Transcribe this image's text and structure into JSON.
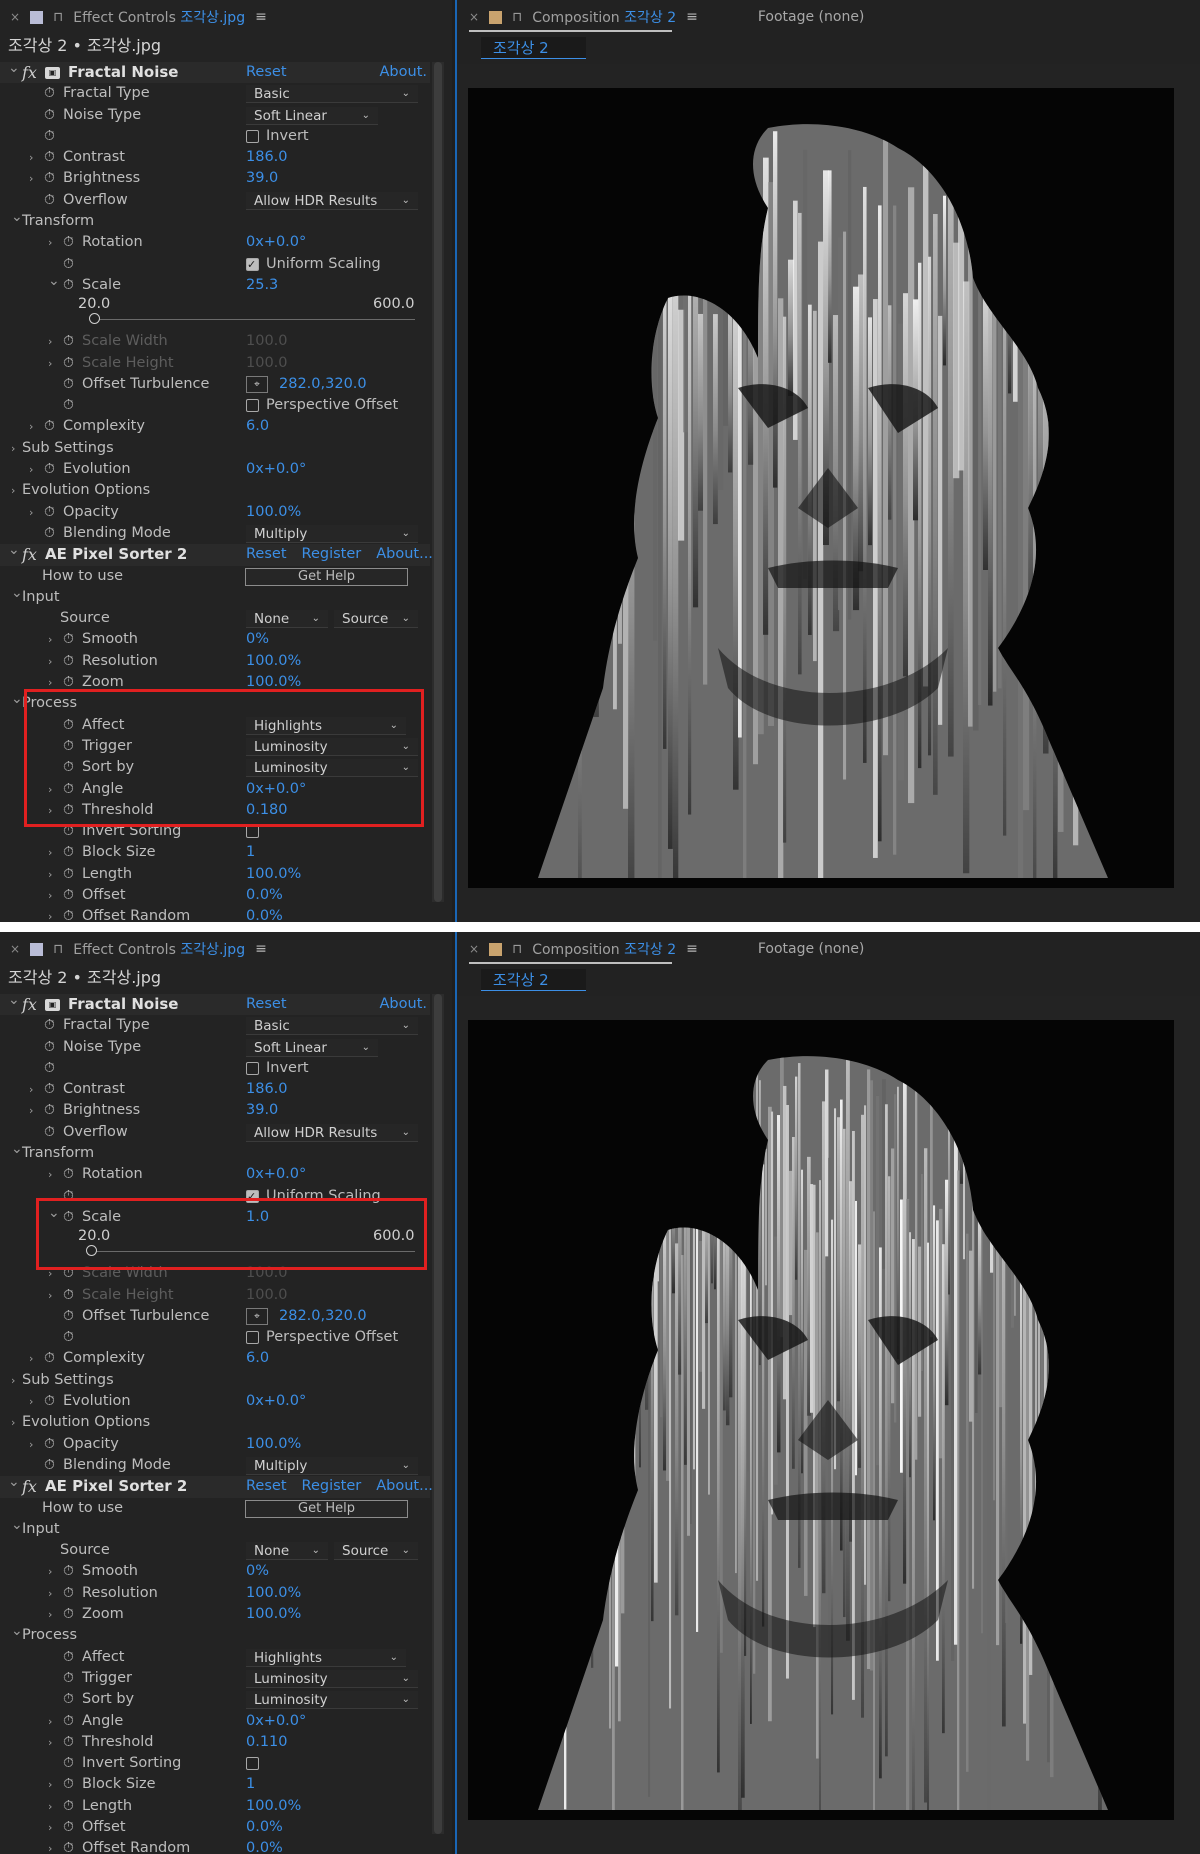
{
  "top": {
    "ec_tab": {
      "close": "×",
      "title_prefix": "Effect Controls",
      "title_name": "조각상.jpg",
      "menu": "≡"
    },
    "ec_header": "조각상 2 • 조각상.jpg",
    "comp_tab": {
      "close": "×",
      "title_prefix": "Composition",
      "title_name": "조각상 2",
      "menu": "≡",
      "footage": "Footage  (none)"
    },
    "comp_subtab": "조각상 2",
    "rows": [
      {
        "k": "fx",
        "label": "Fractal Noise",
        "links": [
          "Reset",
          "About."
        ]
      },
      {
        "k": "dd",
        "ind": 2,
        "tw": 0,
        "sw": 1,
        "label": "Fractal Type",
        "dd": "Basic"
      },
      {
        "k": "dd",
        "ind": 2,
        "tw": 0,
        "sw": 1,
        "label": "Noise Type",
        "dd": "Soft Linear",
        "ddw": 132
      },
      {
        "k": "chk",
        "ind": 2,
        "tw": 0,
        "sw": 1,
        "label": "",
        "chk": false,
        "chkLabel": "Invert"
      },
      {
        "k": "val",
        "ind": 2,
        "tw": 1,
        "sw": 1,
        "label": "Contrast",
        "val": "186.0"
      },
      {
        "k": "val",
        "ind": 2,
        "tw": 1,
        "sw": 1,
        "label": "Brightness",
        "val": "39.0"
      },
      {
        "k": "dd",
        "ind": 2,
        "tw": 0,
        "sw": 1,
        "label": "Overflow",
        "dd": "Allow HDR Results"
      },
      {
        "k": "grp",
        "ind": 1,
        "tw": 2,
        "label": "Transform"
      },
      {
        "k": "val",
        "ind": 3,
        "tw": 1,
        "sw": 1,
        "label": "Rotation",
        "val": "0x+0.0°"
      },
      {
        "k": "chk",
        "ind": 3,
        "tw": 0,
        "sw": 1,
        "label": "",
        "chk": true,
        "chkLabel": "Uniform Scaling"
      },
      {
        "k": "val",
        "ind": 3,
        "tw": 2,
        "sw": 1,
        "label": "Scale",
        "val": "25.3"
      },
      {
        "k": "slider",
        "min": "20.0",
        "max": "600.0",
        "pos": 0.009
      },
      {
        "k": "val",
        "ind": 3,
        "tw": 1,
        "sw": 1,
        "label": "Scale Width",
        "val": "100.0",
        "disabled": true
      },
      {
        "k": "val",
        "ind": 3,
        "tw": 1,
        "sw": 1,
        "label": "Scale Height",
        "val": "100.0",
        "disabled": true
      },
      {
        "k": "pt",
        "ind": 3,
        "tw": 0,
        "sw": 1,
        "label": "Offset Turbulence",
        "val": "282.0,320.0"
      },
      {
        "k": "chk",
        "ind": 3,
        "tw": 0,
        "sw": 1,
        "label": "",
        "chk": false,
        "chkLabel": "Perspective Offset"
      },
      {
        "k": "val",
        "ind": 2,
        "tw": 1,
        "sw": 1,
        "label": "Complexity",
        "val": "6.0"
      },
      {
        "k": "grp",
        "ind": 1,
        "tw": 1,
        "label": "Sub Settings"
      },
      {
        "k": "val",
        "ind": 2,
        "tw": 1,
        "sw": 1,
        "label": "Evolution",
        "val": "0x+0.0°"
      },
      {
        "k": "grp",
        "ind": 1,
        "tw": 1,
        "label": "Evolution Options"
      },
      {
        "k": "val",
        "ind": 2,
        "tw": 1,
        "sw": 1,
        "label": "Opacity",
        "val": "100.0%"
      },
      {
        "k": "dd",
        "ind": 2,
        "tw": 0,
        "sw": 1,
        "label": "Blending Mode",
        "dd": "Multiply"
      },
      {
        "k": "fx2",
        "label": "AE Pixel Sorter 2",
        "links": [
          "Reset",
          "Register",
          "About..."
        ]
      },
      {
        "k": "btn",
        "ind": 1,
        "tw": 0,
        "label": "How to use",
        "btn": "Get Help"
      },
      {
        "k": "grp",
        "ind": 1,
        "tw": 2,
        "label": "Input"
      },
      {
        "k": "dd2",
        "ind": 2,
        "tw": 0,
        "label": "Source",
        "dd": "None",
        "dd2": "Source"
      },
      {
        "k": "val",
        "ind": 3,
        "tw": 1,
        "sw": 1,
        "label": "Smooth",
        "val": "0%"
      },
      {
        "k": "val",
        "ind": 3,
        "tw": 1,
        "sw": 1,
        "label": "Resolution",
        "val": "100.0%"
      },
      {
        "k": "val",
        "ind": 3,
        "tw": 1,
        "sw": 1,
        "label": "Zoom",
        "val": "100.0%"
      },
      {
        "k": "grp",
        "ind": 1,
        "tw": 2,
        "label": "Process"
      },
      {
        "k": "dd",
        "ind": 3,
        "tw": 0,
        "sw": 1,
        "label": "Affect",
        "dd": "Highlights",
        "ddw": 160
      },
      {
        "k": "dd",
        "ind": 3,
        "tw": 0,
        "sw": 1,
        "label": "Trigger",
        "dd": "Luminosity"
      },
      {
        "k": "dd",
        "ind": 3,
        "tw": 0,
        "sw": 1,
        "label": "Sort by",
        "dd": "Luminosity"
      },
      {
        "k": "val",
        "ind": 3,
        "tw": 1,
        "sw": 1,
        "label": "Angle",
        "val": "0x+0.0°"
      },
      {
        "k": "val",
        "ind": 3,
        "tw": 1,
        "sw": 1,
        "label": "Threshold",
        "val": "0.180"
      },
      {
        "k": "chk",
        "ind": 3,
        "tw": 0,
        "sw": 1,
        "label": "Invert Sorting",
        "chk": false,
        "chkLabel": ""
      },
      {
        "k": "val",
        "ind": 3,
        "tw": 1,
        "sw": 1,
        "label": "Block Size",
        "val": "1"
      },
      {
        "k": "val",
        "ind": 3,
        "tw": 1,
        "sw": 1,
        "label": "Length",
        "val": "100.0%"
      },
      {
        "k": "val",
        "ind": 3,
        "tw": 1,
        "sw": 1,
        "label": "Offset",
        "val": "0.0%"
      },
      {
        "k": "val",
        "ind": 3,
        "tw": 1,
        "sw": 1,
        "label": "Offset Random",
        "val": "0.0%"
      }
    ],
    "highlight": "process"
  },
  "bottom": {
    "ec_tab": {
      "close": "×",
      "title_prefix": "Effect Controls",
      "title_name": "조각상.jpg",
      "menu": "≡"
    },
    "ec_header": "조각상 2 • 조각상.jpg",
    "comp_tab": {
      "close": "×",
      "title_prefix": "Composition",
      "title_name": "조각상 2",
      "menu": "≡",
      "footage": "Footage  (none)"
    },
    "comp_subtab": "조각상 2",
    "rows": [
      {
        "k": "fx",
        "label": "Fractal Noise",
        "links": [
          "Reset",
          "About."
        ]
      },
      {
        "k": "dd",
        "ind": 2,
        "tw": 0,
        "sw": 1,
        "label": "Fractal Type",
        "dd": "Basic"
      },
      {
        "k": "dd",
        "ind": 2,
        "tw": 0,
        "sw": 1,
        "label": "Noise Type",
        "dd": "Soft Linear",
        "ddw": 132
      },
      {
        "k": "chk",
        "ind": 2,
        "tw": 0,
        "sw": 1,
        "label": "",
        "chk": false,
        "chkLabel": "Invert"
      },
      {
        "k": "val",
        "ind": 2,
        "tw": 1,
        "sw": 1,
        "label": "Contrast",
        "val": "186.0"
      },
      {
        "k": "val",
        "ind": 2,
        "tw": 1,
        "sw": 1,
        "label": "Brightness",
        "val": "39.0"
      },
      {
        "k": "dd",
        "ind": 2,
        "tw": 0,
        "sw": 1,
        "label": "Overflow",
        "dd": "Allow HDR Results"
      },
      {
        "k": "grp",
        "ind": 1,
        "tw": 2,
        "label": "Transform"
      },
      {
        "k": "val",
        "ind": 3,
        "tw": 1,
        "sw": 1,
        "label": "Rotation",
        "val": "0x+0.0°"
      },
      {
        "k": "chk",
        "ind": 3,
        "tw": 0,
        "sw": 1,
        "label": "",
        "chk": true,
        "chkLabel": "Uniform Scaling"
      },
      {
        "k": "val",
        "ind": 3,
        "tw": 2,
        "sw": 1,
        "label": "Scale",
        "val": "1.0"
      },
      {
        "k": "slider",
        "min": "20.0",
        "max": "600.0",
        "pos": 0.0
      },
      {
        "k": "val",
        "ind": 3,
        "tw": 1,
        "sw": 1,
        "label": "Scale Width",
        "val": "100.0",
        "disabled": true
      },
      {
        "k": "val",
        "ind": 3,
        "tw": 1,
        "sw": 1,
        "label": "Scale Height",
        "val": "100.0",
        "disabled": true
      },
      {
        "k": "pt",
        "ind": 3,
        "tw": 0,
        "sw": 1,
        "label": "Offset Turbulence",
        "val": "282.0,320.0"
      },
      {
        "k": "chk",
        "ind": 3,
        "tw": 0,
        "sw": 1,
        "label": "",
        "chk": false,
        "chkLabel": "Perspective Offset"
      },
      {
        "k": "val",
        "ind": 2,
        "tw": 1,
        "sw": 1,
        "label": "Complexity",
        "val": "6.0"
      },
      {
        "k": "grp",
        "ind": 1,
        "tw": 1,
        "label": "Sub Settings"
      },
      {
        "k": "val",
        "ind": 2,
        "tw": 1,
        "sw": 1,
        "label": "Evolution",
        "val": "0x+0.0°"
      },
      {
        "k": "grp",
        "ind": 1,
        "tw": 1,
        "label": "Evolution Options"
      },
      {
        "k": "val",
        "ind": 2,
        "tw": 1,
        "sw": 1,
        "label": "Opacity",
        "val": "100.0%"
      },
      {
        "k": "dd",
        "ind": 2,
        "tw": 0,
        "sw": 1,
        "label": "Blending Mode",
        "dd": "Multiply"
      },
      {
        "k": "fx2",
        "label": "AE Pixel Sorter 2",
        "links": [
          "Reset",
          "Register",
          "About..."
        ]
      },
      {
        "k": "btn",
        "ind": 1,
        "tw": 0,
        "label": "How to use",
        "btn": "Get Help"
      },
      {
        "k": "grp",
        "ind": 1,
        "tw": 2,
        "label": "Input"
      },
      {
        "k": "dd2",
        "ind": 2,
        "tw": 0,
        "label": "Source",
        "dd": "None",
        "dd2": "Source"
      },
      {
        "k": "val",
        "ind": 3,
        "tw": 1,
        "sw": 1,
        "label": "Smooth",
        "val": "0%"
      },
      {
        "k": "val",
        "ind": 3,
        "tw": 1,
        "sw": 1,
        "label": "Resolution",
        "val": "100.0%"
      },
      {
        "k": "val",
        "ind": 3,
        "tw": 1,
        "sw": 1,
        "label": "Zoom",
        "val": "100.0%"
      },
      {
        "k": "grp",
        "ind": 1,
        "tw": 2,
        "label": "Process"
      },
      {
        "k": "dd",
        "ind": 3,
        "tw": 0,
        "sw": 1,
        "label": "Affect",
        "dd": "Highlights",
        "ddw": 160
      },
      {
        "k": "dd",
        "ind": 3,
        "tw": 0,
        "sw": 1,
        "label": "Trigger",
        "dd": "Luminosity"
      },
      {
        "k": "dd",
        "ind": 3,
        "tw": 0,
        "sw": 1,
        "label": "Sort by",
        "dd": "Luminosity"
      },
      {
        "k": "val",
        "ind": 3,
        "tw": 1,
        "sw": 1,
        "label": "Angle",
        "val": "0x+0.0°"
      },
      {
        "k": "val",
        "ind": 3,
        "tw": 1,
        "sw": 1,
        "label": "Threshold",
        "val": "0.110"
      },
      {
        "k": "chk",
        "ind": 3,
        "tw": 0,
        "sw": 1,
        "label": "Invert Sorting",
        "chk": false,
        "chkLabel": ""
      },
      {
        "k": "val",
        "ind": 3,
        "tw": 1,
        "sw": 1,
        "label": "Block Size",
        "val": "1"
      },
      {
        "k": "val",
        "ind": 3,
        "tw": 1,
        "sw": 1,
        "label": "Length",
        "val": "100.0%"
      },
      {
        "k": "val",
        "ind": 3,
        "tw": 1,
        "sw": 1,
        "label": "Offset",
        "val": "0.0%"
      },
      {
        "k": "val",
        "ind": 3,
        "tw": 1,
        "sw": 1,
        "label": "Offset Random",
        "val": "0.0%"
      }
    ],
    "highlight": "scale"
  },
  "colors": {
    "accent_blue": "#3c8fe6",
    "highlight_red": "#e12020",
    "panel_bg": "#232323"
  },
  "icons": [
    "close-icon",
    "lock-icon",
    "hamburger-menu-icon",
    "twirl-arrow-icon",
    "stopwatch-icon",
    "fx-icon",
    "checkbox-icon",
    "dropdown-caret-icon",
    "crosshair-point-icon"
  ]
}
